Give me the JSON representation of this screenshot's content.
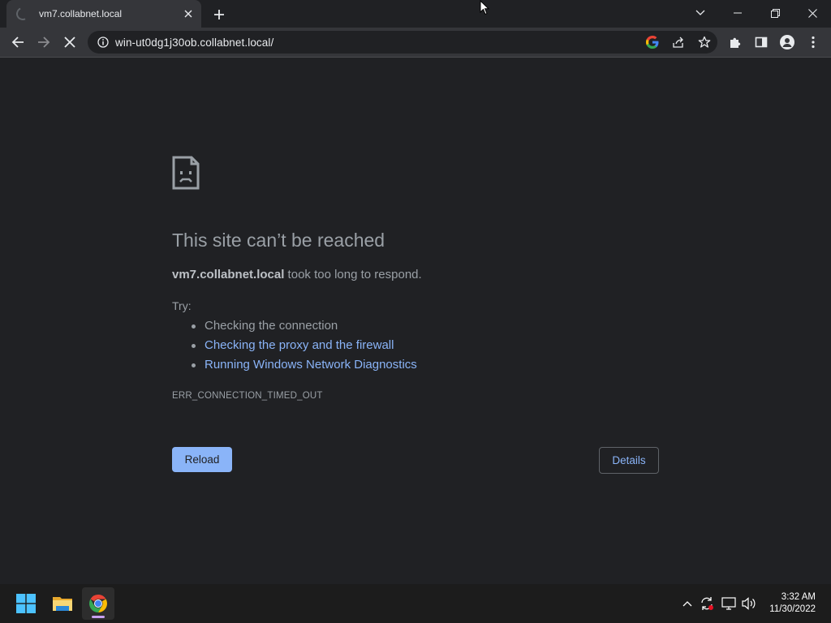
{
  "browser": {
    "tab": {
      "title": "vm7.collabnet.local",
      "close_icon": "close-icon"
    },
    "url": "win-ut0dg1j30ob.collabnet.local/",
    "accent": "#8ab4f8"
  },
  "error_page": {
    "title": "This site can’t be reached",
    "host": "vm7.collabnet.local",
    "desc_suffix": " took too long to respond.",
    "try_label": "Try:",
    "suggestions": [
      {
        "text": "Checking the connection",
        "link": false
      },
      {
        "text": "Checking the proxy and the firewall",
        "link": true
      },
      {
        "text": "Running Windows Network Diagnostics",
        "link": true
      }
    ],
    "error_code": "ERR_CONNECTION_TIMED_OUT",
    "reload_label": "Reload",
    "details_label": "Details"
  },
  "taskbar": {
    "apps": [
      "start-icon",
      "file-explorer-icon",
      "chrome-icon"
    ],
    "time": "3:32 AM",
    "date": "11/30/2022"
  }
}
